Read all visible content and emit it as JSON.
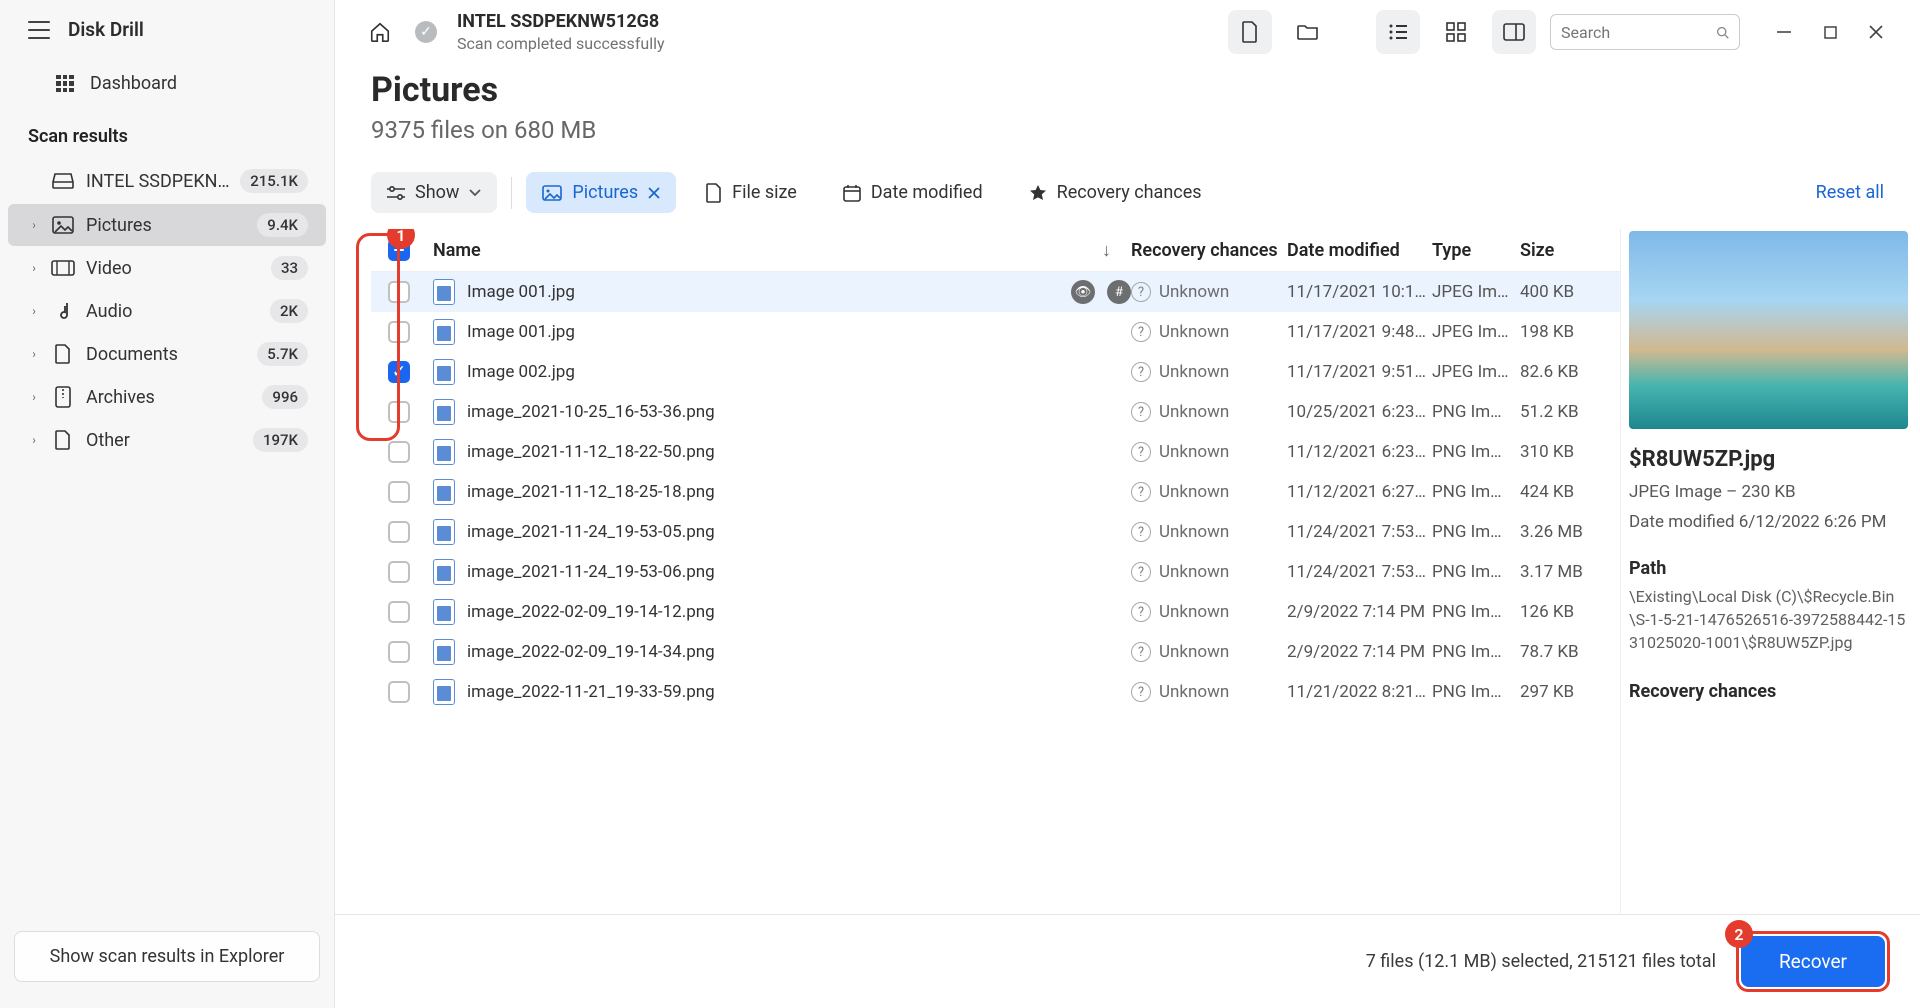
{
  "app": {
    "title": "Disk Drill"
  },
  "sidebar": {
    "dashboard": "Dashboard",
    "section": "Scan results",
    "drive": {
      "label": "INTEL SSDPEKNW512…",
      "badge": "215.1K"
    },
    "items": [
      {
        "label": "Pictures",
        "badge": "9.4K",
        "active": true
      },
      {
        "label": "Video",
        "badge": "33"
      },
      {
        "label": "Audio",
        "badge": "2K"
      },
      {
        "label": "Documents",
        "badge": "5.7K"
      },
      {
        "label": "Archives",
        "badge": "996"
      },
      {
        "label": "Other",
        "badge": "197K"
      }
    ],
    "explorer": "Show scan results in Explorer"
  },
  "header": {
    "device": "INTEL SSDPEKNW512G8",
    "status": "Scan completed successfully",
    "search_placeholder": "Search"
  },
  "page": {
    "title": "Pictures",
    "subtitle": "9375 files on 680 MB"
  },
  "filters": {
    "show": "Show",
    "pictures": "Pictures",
    "filesize": "File size",
    "date": "Date modified",
    "chances": "Recovery chances",
    "reset": "Reset all"
  },
  "columns": {
    "name": "Name",
    "recovery": "Recovery chances",
    "date": "Date modified",
    "type": "Type",
    "size": "Size"
  },
  "rows": [
    {
      "checked": false,
      "name": "Image 001.jpg",
      "eye": true,
      "recovery": "Unknown",
      "date": "11/17/2021 10:1…",
      "type": "JPEG Im…",
      "size": "400 KB"
    },
    {
      "checked": false,
      "name": "Image 001.jpg",
      "recovery": "Unknown",
      "date": "11/17/2021 9:48…",
      "type": "JPEG Im…",
      "size": "198 KB"
    },
    {
      "checked": true,
      "name": "Image 002.jpg",
      "recovery": "Unknown",
      "date": "11/17/2021 9:51…",
      "type": "JPEG Im…",
      "size": "82.6 KB"
    },
    {
      "checked": false,
      "name": "image_2021-10-25_16-53-36.png",
      "recovery": "Unknown",
      "date": "10/25/2021 6:23…",
      "type": "PNG Im…",
      "size": "51.2 KB"
    },
    {
      "checked": false,
      "name": "image_2021-11-12_18-22-50.png",
      "recovery": "Unknown",
      "date": "11/12/2021 6:23…",
      "type": "PNG Im…",
      "size": "310 KB"
    },
    {
      "checked": false,
      "name": "image_2021-11-12_18-25-18.png",
      "recovery": "Unknown",
      "date": "11/12/2021 6:27…",
      "type": "PNG Im…",
      "size": "424 KB"
    },
    {
      "checked": false,
      "name": "image_2021-11-24_19-53-05.png",
      "recovery": "Unknown",
      "date": "11/24/2021 7:53…",
      "type": "PNG Im…",
      "size": "3.26 MB"
    },
    {
      "checked": false,
      "name": "image_2021-11-24_19-53-06.png",
      "recovery": "Unknown",
      "date": "11/24/2021 7:53…",
      "type": "PNG Im…",
      "size": "3.17 MB"
    },
    {
      "checked": false,
      "name": "image_2022-02-09_19-14-12.png",
      "recovery": "Unknown",
      "date": "2/9/2022 7:14 PM",
      "type": "PNG Im…",
      "size": "126 KB"
    },
    {
      "checked": false,
      "name": "image_2022-02-09_19-14-34.png",
      "recovery": "Unknown",
      "date": "2/9/2022 7:14 PM",
      "type": "PNG Im…",
      "size": "78.7 KB"
    },
    {
      "checked": false,
      "name": "image_2022-11-21_19-33-59.png",
      "recovery": "Unknown",
      "date": "11/21/2022 8:21…",
      "type": "PNG Im…",
      "size": "297 KB"
    }
  ],
  "preview": {
    "filename": "$R8UW5ZP.jpg",
    "meta1": "JPEG Image – 230 KB",
    "meta2": "Date modified 6/12/2022 6:26 PM",
    "path_label": "Path",
    "path": "\\Existing\\Local Disk (C)\\$Recycle.Bin\\S-1-5-21-1476526516-3972588442-1531025020-1001\\$R8UW5ZP.jpg",
    "chances_label": "Recovery chances"
  },
  "footer": {
    "summary": "7 files (12.1 MB) selected, 215121 files total",
    "recover": "Recover"
  },
  "annotations": {
    "a1": "1",
    "a2": "2"
  }
}
